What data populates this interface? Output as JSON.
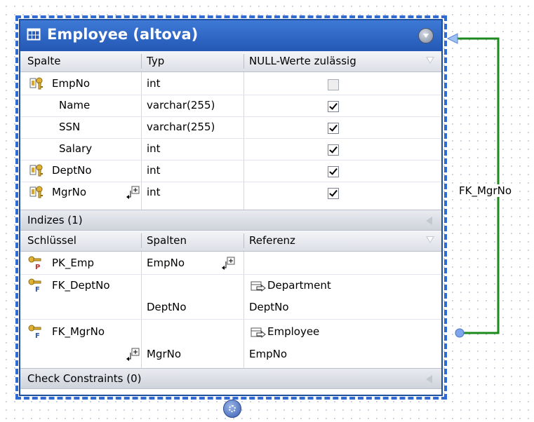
{
  "table": {
    "title": "Employee (altova)",
    "columns_header": {
      "col1": "Spalte",
      "col2": "Typ",
      "col3": "NULL-Werte zulässig"
    },
    "columns": [
      {
        "name": "EmpNo",
        "type": "int",
        "nullable": false,
        "key": true,
        "has_index_marker": false
      },
      {
        "name": "Name",
        "type": "varchar(255)",
        "nullable": true,
        "key": false,
        "has_index_marker": false
      },
      {
        "name": "SSN",
        "type": "varchar(255)",
        "nullable": true,
        "key": false,
        "has_index_marker": false
      },
      {
        "name": "Salary",
        "type": "int",
        "nullable": true,
        "key": false,
        "has_index_marker": false
      },
      {
        "name": "DeptNo",
        "type": "int",
        "nullable": true,
        "key": true,
        "has_index_marker": false
      },
      {
        "name": "MgrNo",
        "type": "int",
        "nullable": true,
        "key": true,
        "has_index_marker": true
      }
    ],
    "indexes_section": "Indizes (1)",
    "keys_header": {
      "col1": "Schlüssel",
      "col2": "Spalten",
      "col3": "Referenz"
    },
    "keys": {
      "pk": {
        "name": "PK_Emp",
        "column": "EmpNo"
      },
      "fk1": {
        "name": "FK_DeptNo",
        "ref_table": "Department",
        "column": "DeptNo",
        "ref_column": "DeptNo"
      },
      "fk2": {
        "name": "FK_MgrNo",
        "ref_table": "Employee",
        "column": "MgrNo",
        "ref_column": "EmpNo"
      }
    },
    "check_section": "Check Constraints (0)"
  },
  "relation": {
    "label": "FK_MgrNo",
    "color": "#1d8a1d"
  },
  "colors": {
    "title_bar": "#2f66c4",
    "selection": "#2f6bd3"
  }
}
